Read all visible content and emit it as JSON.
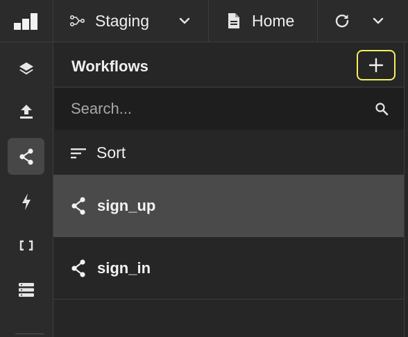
{
  "topbar": {
    "environment": {
      "label": "Staging",
      "icon": "workflow-branch-icon"
    },
    "page": {
      "label": "Home",
      "icon": "document-icon"
    },
    "refresh": {
      "icon": "refresh-icon"
    }
  },
  "rail": {
    "items": [
      {
        "name": "layers",
        "icon": "layers-icon",
        "active": false
      },
      {
        "name": "upload",
        "icon": "upload-icon",
        "active": false
      },
      {
        "name": "workflows",
        "icon": "share-nodes-icon",
        "active": true
      },
      {
        "name": "actions",
        "icon": "lightning-icon",
        "active": false
      },
      {
        "name": "variables",
        "icon": "brackets-icon",
        "active": false
      },
      {
        "name": "database",
        "icon": "database-icon",
        "active": false
      }
    ]
  },
  "panel": {
    "title": "Workflows",
    "search": {
      "placeholder": "Search...",
      "value": ""
    },
    "sort_label": "Sort",
    "workflows": [
      {
        "label": "sign_up",
        "selected": true
      },
      {
        "label": "sign_in",
        "selected": false
      }
    ]
  },
  "colors": {
    "background": "#262626",
    "bar": "#2b2b2b",
    "selected_row": "#4a4a4a",
    "add_button_outline": "#f5f060",
    "search_bg": "#1e1e1e"
  }
}
